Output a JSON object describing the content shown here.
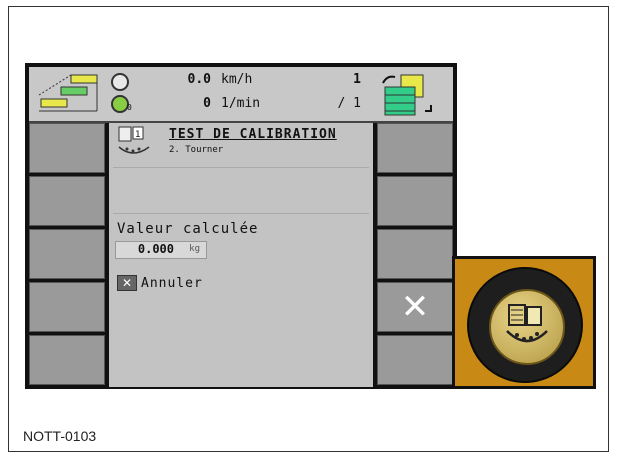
{
  "header": {
    "speed_value": "0.0",
    "speed_unit": "km/h",
    "rpm_value": "0",
    "rpm_unit": "1/min",
    "rpm_mode": "0",
    "page_current": "1",
    "page_total": "/ 1"
  },
  "panel": {
    "title": "TEST DE CALIBRATION",
    "subtitle": "2. Tourner",
    "value_label": "Valeur calculée",
    "value": "0.000",
    "value_unit": "kg",
    "cancel_label": "Annuler"
  },
  "softkeys_right": {
    "cancel_symbol": "✕"
  },
  "cancel_box_symbol": "✕",
  "caption": "NOTT-0103",
  "colors": {
    "knob_accent": "#c88a15",
    "screen_bg": "#c3c3c3"
  }
}
